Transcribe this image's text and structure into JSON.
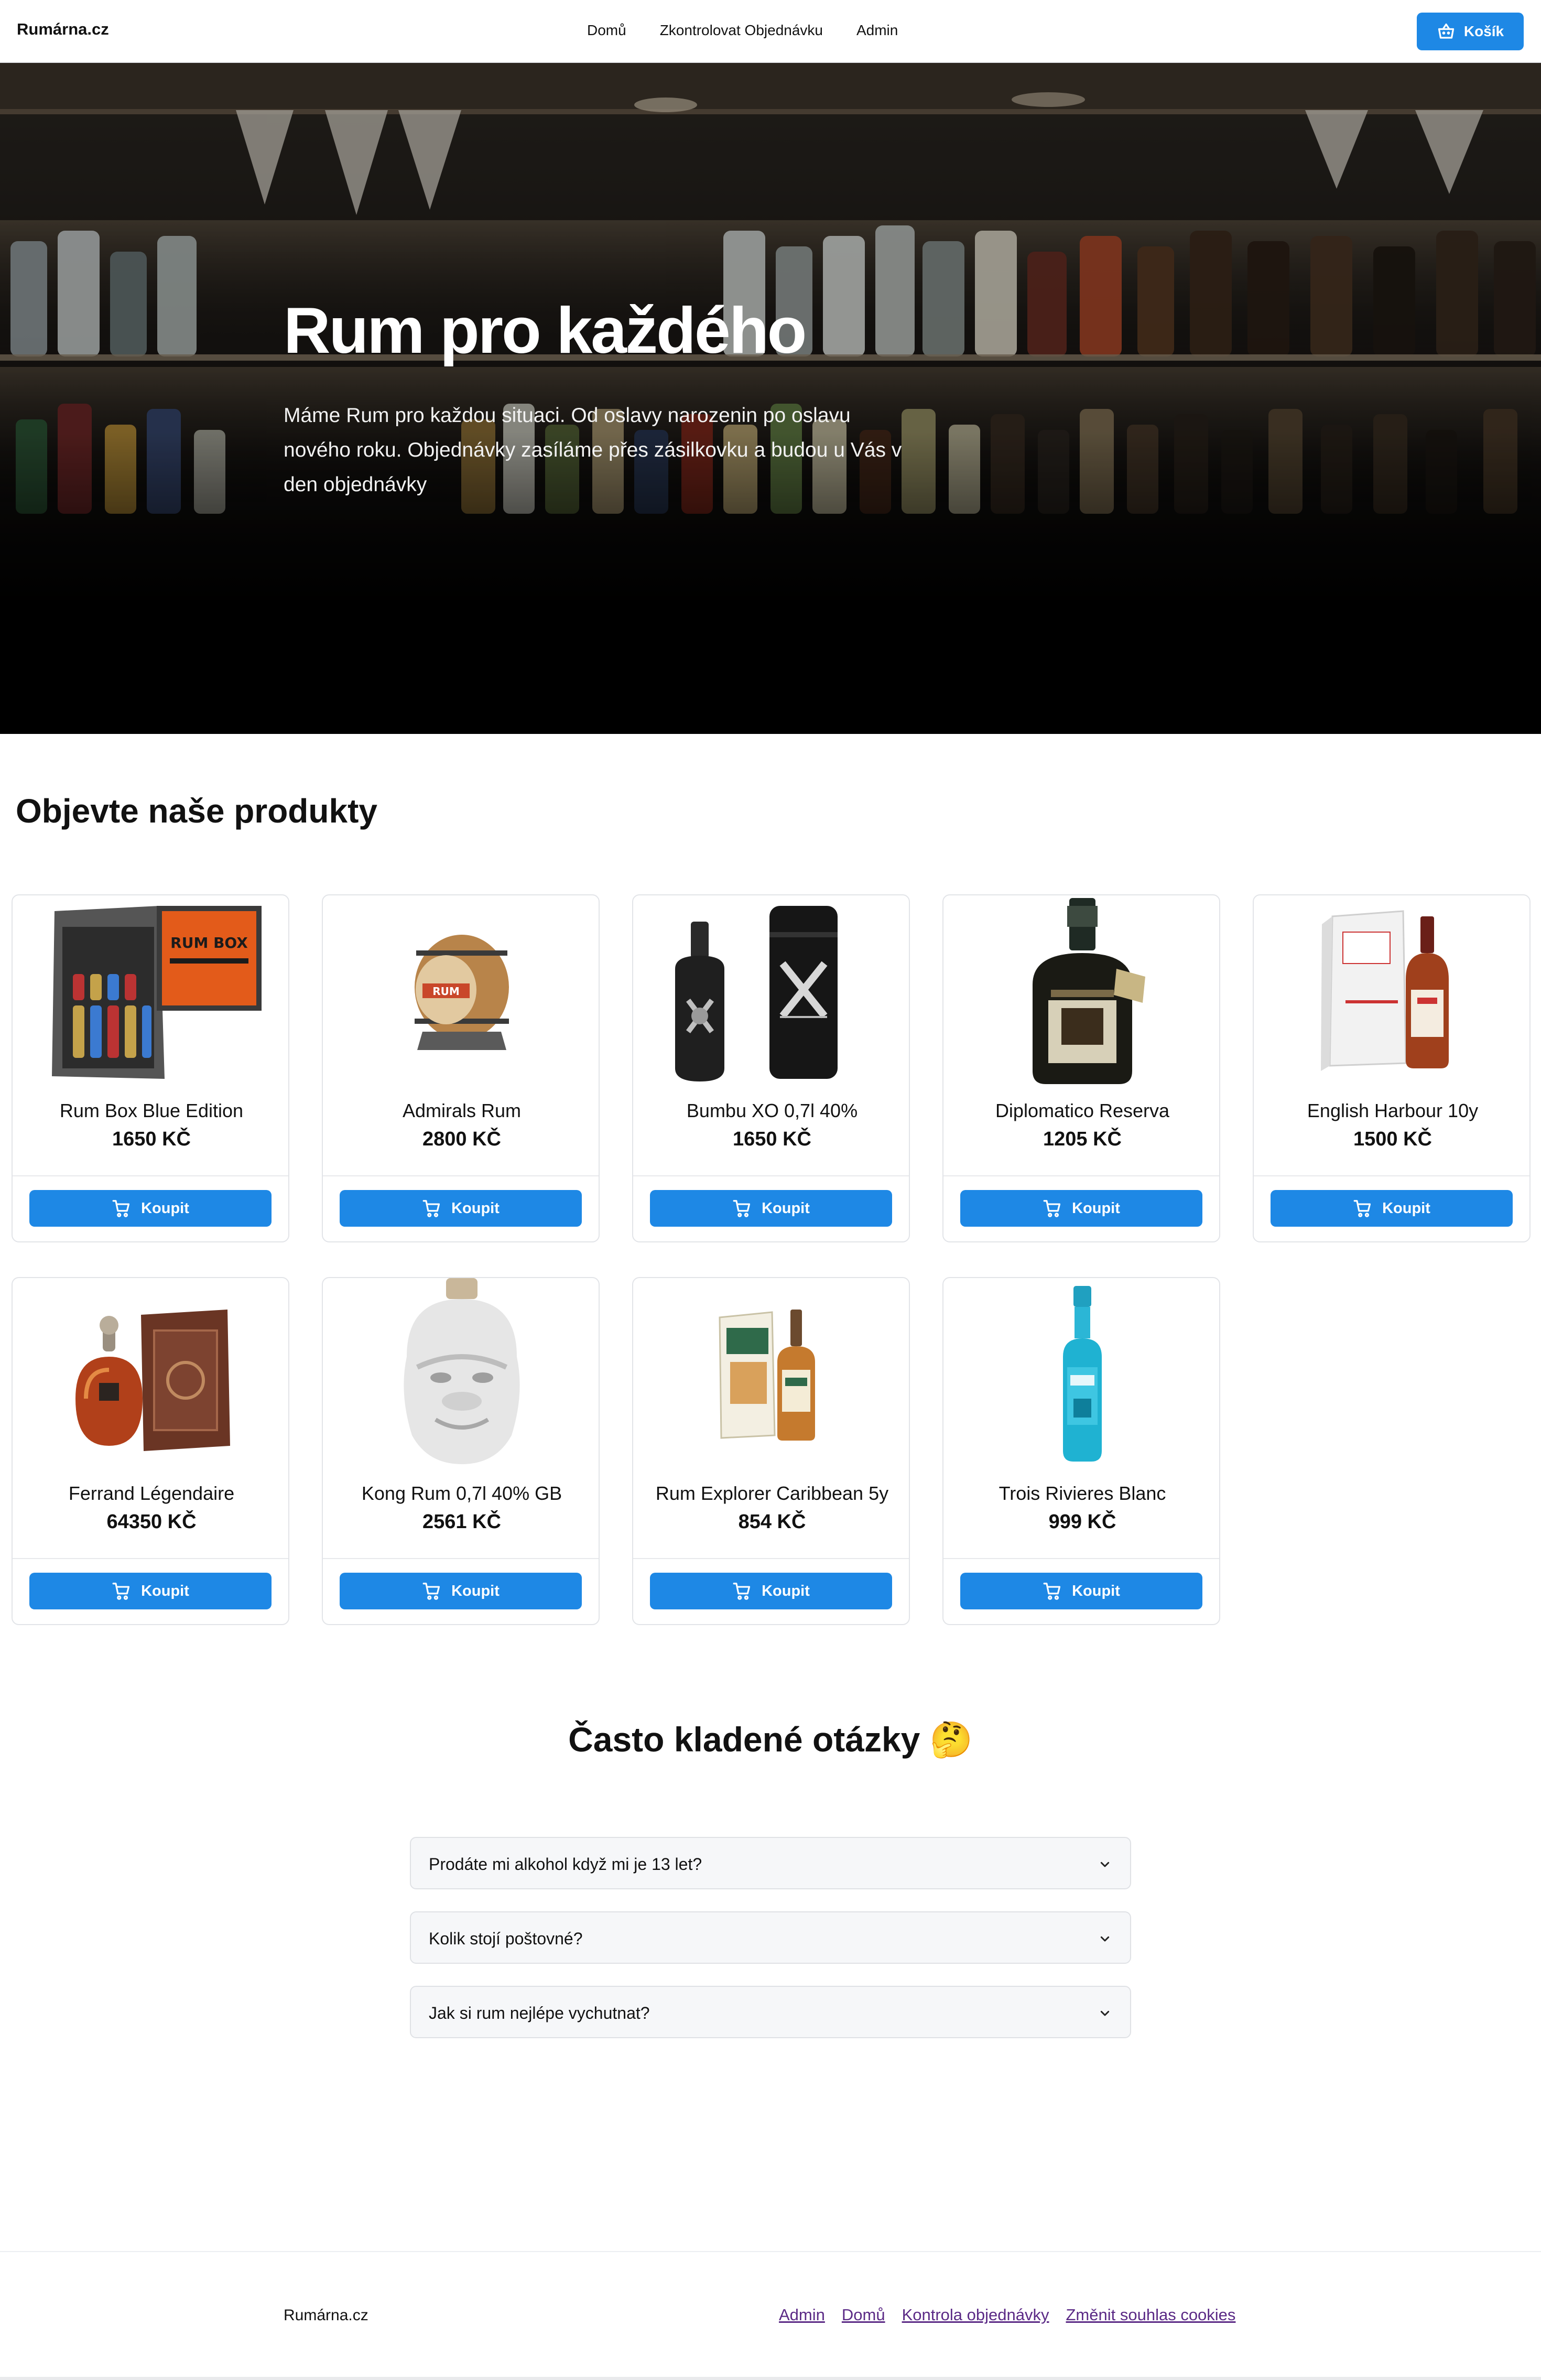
{
  "header": {
    "brand": "Rumárna.cz",
    "nav": [
      "Domů",
      "Zkontrolovat Objednávku",
      "Admin"
    ],
    "cart_label": "Košík"
  },
  "hero": {
    "title": "Rum pro každého",
    "text": "Máme Rum pro každou situaci. Od oslavy narozenin po oslavu nového roku. Objednávky zasíláme přes zásilkovku a budou u Vás v den objednávky"
  },
  "products": {
    "title": "Objevte naše produkty",
    "buy_label": "Koupit",
    "items": [
      {
        "name": "Rum Box Blue Edition",
        "price": "1650 KČ",
        "box_text": "RUM BOX"
      },
      {
        "name": "Admirals Rum",
        "price": "2800 KČ",
        "label_text": "RUM"
      },
      {
        "name": "Bumbu XO 0,7l 40%",
        "price": "1650 KČ"
      },
      {
        "name": "Diplomatico Reserva",
        "price": "1205 KČ"
      },
      {
        "name": "English Harbour 10y",
        "price": "1500 KČ"
      },
      {
        "name": "Ferrand Légendaire",
        "price": "64350 KČ"
      },
      {
        "name": "Kong Rum 0,7l 40% GB",
        "price": "2561 KČ"
      },
      {
        "name": "Rum Explorer Caribbean 5y",
        "price": "854 KČ"
      },
      {
        "name": "Trois Rivieres Blanc",
        "price": "999 KČ"
      }
    ]
  },
  "faq": {
    "title": "Často kladené otázky 🤔",
    "items": [
      "Prodáte mi alkohol když mi je 13 let?",
      "Kolik stojí poštovné?",
      "Jak si rum nejlépe vychutnat?"
    ]
  },
  "footer": {
    "brand": "Rumárna.cz",
    "links": [
      "Admin",
      "Domů",
      "Kontrola objednávky",
      "Změnit souhlas cookies"
    ]
  },
  "colors": {
    "accent": "#1e88e5",
    "footer_link": "#5b2a86"
  },
  "icons": {
    "cart_button": "basket-icon",
    "buy_button": "shopping-cart-icon",
    "faq_toggle": "chevron-down-icon"
  }
}
